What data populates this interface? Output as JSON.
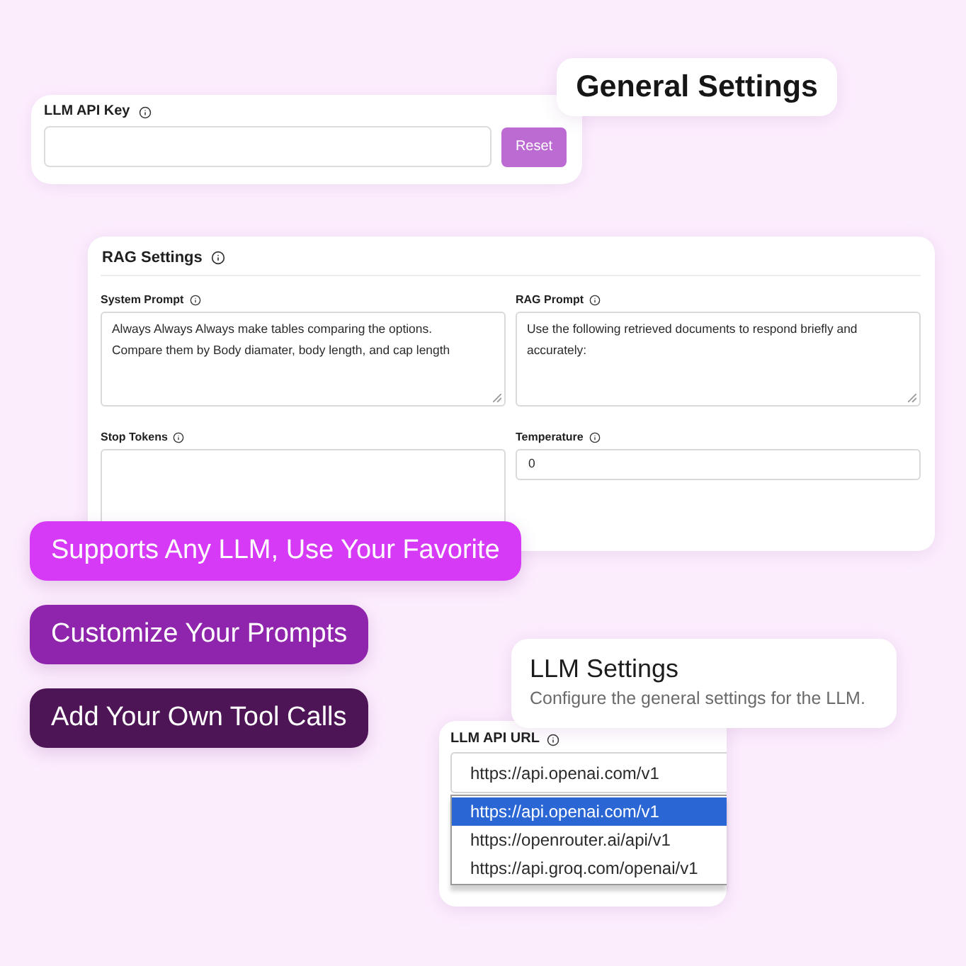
{
  "badge": {
    "title": "General Settings"
  },
  "api_key": {
    "label": "LLM API Key",
    "button": "Reset"
  },
  "rag_settings": {
    "title": "RAG Settings",
    "fields": [
      {
        "label": "System Prompt",
        "kind": "textarea",
        "value": "Always Always Always make tables comparing the options.\nCompare them by Body diamater, body length, and cap length"
      },
      {
        "label": "RAG Prompt",
        "kind": "textarea",
        "value": "Use the following retrieved documents to respond briefly and accurately:"
      },
      {
        "label": "Stop Tokens",
        "kind": "textarea"
      },
      {
        "label": "Temperature",
        "kind": "input",
        "value": "0"
      }
    ]
  },
  "features": [
    {
      "label": "Supports Any LLM, Use Your Favorite",
      "color": "#d63af7"
    },
    {
      "label": "Customize Your Prompts",
      "color": "#8f25ac"
    },
    {
      "label": "Add Your Own Tool Calls",
      "color": "#4e1556"
    }
  ],
  "llm_settings": {
    "title": "LLM Settings",
    "description": "Configure the general settings for the LLM."
  },
  "api_url": {
    "label": "LLM API URL",
    "value": "https://api.openai.com/v1",
    "expanded": true,
    "options": [
      {
        "label": "https://api.openai.com/v1",
        "selected": true
      },
      {
        "label": "https://openrouter.ai/api/v1",
        "selected": false
      },
      {
        "label": "https://api.groq.com/openai/v1",
        "selected": false
      }
    ]
  }
}
